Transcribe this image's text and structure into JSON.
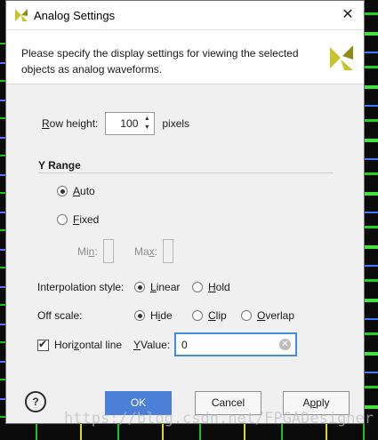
{
  "dialog": {
    "title": "Analog Settings",
    "close_label": "✕",
    "description": "Please specify the display settings for viewing the selected objects as analog waveforms."
  },
  "row_height": {
    "label_u": "R",
    "label_rest": "ow height:",
    "value": "100",
    "unit": "pixels"
  },
  "y_range": {
    "title": "Y Range",
    "auto_u": "A",
    "auto_rest": "uto",
    "fixed_u": "F",
    "fixed_rest": "ixed",
    "min_pre": "Mi",
    "min_u": "n",
    "min_post": ":",
    "max_pre": "Ma",
    "max_u": "x",
    "max_post": ":",
    "selected": "Auto"
  },
  "interpolation": {
    "label": "Interpolation style:",
    "linear_u": "L",
    "linear_rest": "inear",
    "hold_u": "H",
    "hold_rest": "old",
    "selected": "Linear"
  },
  "off_scale": {
    "label": "Off scale:",
    "hide_pre": "H",
    "hide_u": "i",
    "hide_post": "de",
    "clip_u": "C",
    "clip_rest": "lip",
    "overlap_u": "O",
    "overlap_rest": "verlap",
    "selected": "Hide"
  },
  "horizontal_line": {
    "checked": true,
    "label_pre": "Hori",
    "label_u": "z",
    "label_post": "ontal line",
    "yvalue_u": "Y",
    "yvalue_rest": " Value:",
    "value": "0"
  },
  "buttons": {
    "help": "?",
    "ok": "OK",
    "cancel": "Cancel",
    "apply_pre": "A",
    "apply_u": "p",
    "apply_post": "ply"
  },
  "watermark": "https://blog.csdn.net/FPGADesigner",
  "colors": {
    "accent": "#4c7fd6",
    "focus": "#3f8ee0",
    "logo": "#b5b21e"
  }
}
